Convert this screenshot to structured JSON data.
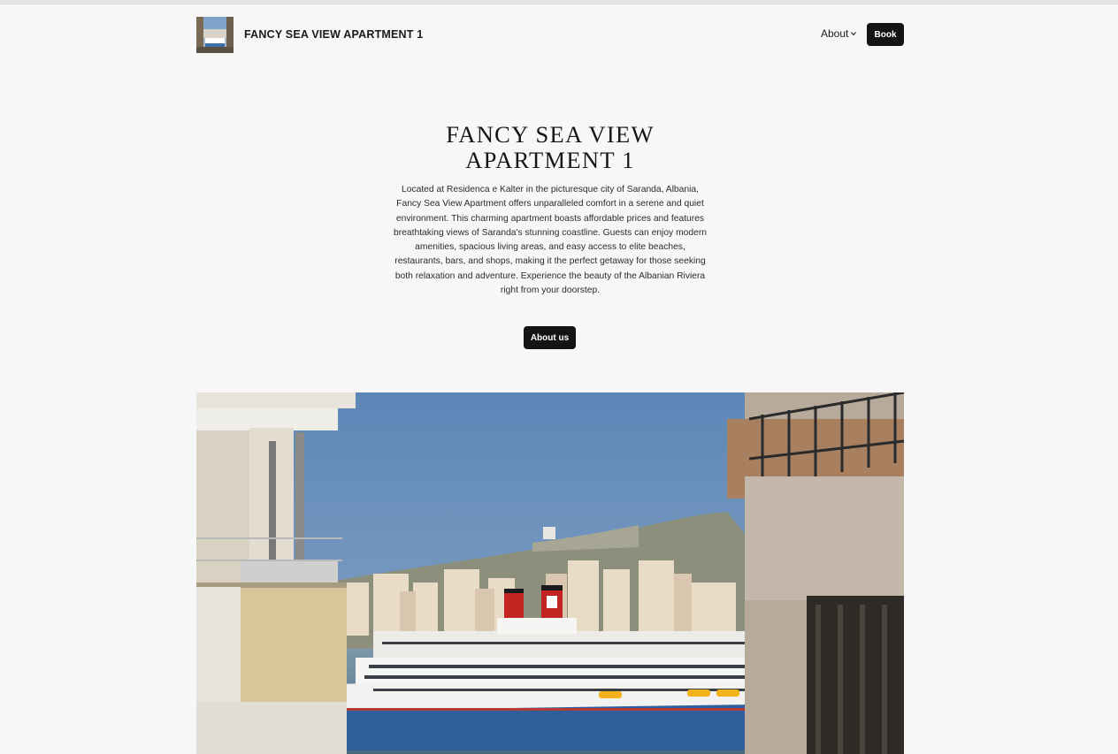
{
  "header": {
    "site_title": "FANCY SEA VIEW APARTMENT 1",
    "nav_about_label": "About",
    "book_label": "Book"
  },
  "hero": {
    "title_line1": "FANCY SEA VIEW",
    "title_line2": "APARTMENT 1",
    "description": "Located at Residenca e Kalter in the picturesque city of Saranda, Albania, Fancy Sea View Apartment offers unparalleled comfort in a serene and quiet environment. This charming apartment boasts affordable prices and features breathtaking views of Saranda's stunning coastline. Guests can enjoy modern amenities, spacious living areas, and easy access to elite beaches, restaurants, bars, and shops, making it the perfect getaway for those seeking both relaxation and adventure. Experience the beauty of the Albanian Riviera right from your doorstep.",
    "about_button_label": "About us"
  },
  "colors": {
    "background": "#f7f7f7",
    "button_bg": "#141414",
    "button_text": "#ffffff",
    "text": "#111111"
  },
  "icons": {
    "nav_dropdown": "chevron-down-icon",
    "logo": "logo-image",
    "hero_photo": "hero-photo"
  }
}
